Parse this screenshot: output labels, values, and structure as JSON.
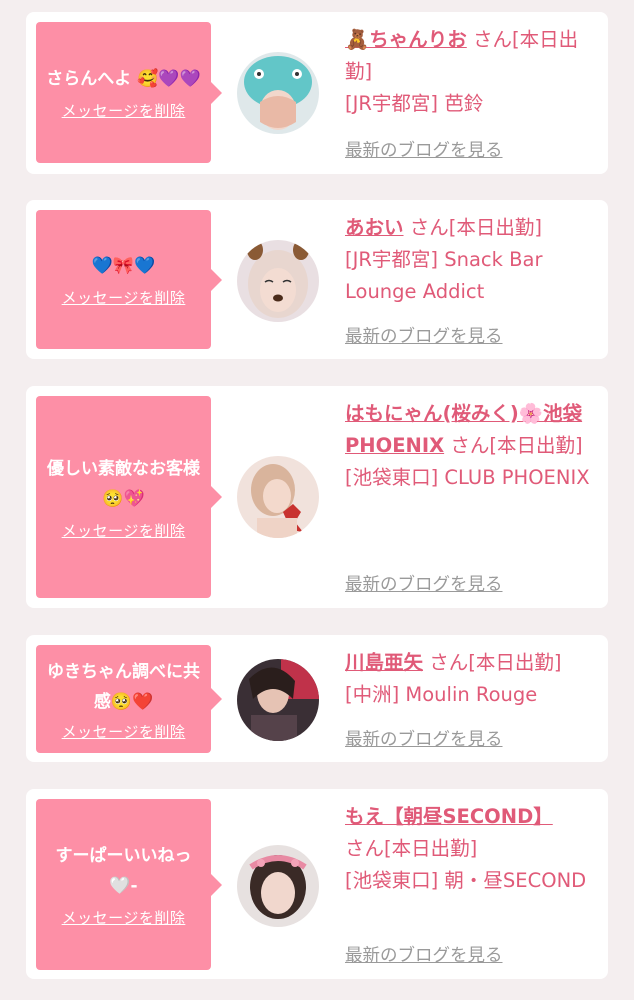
{
  "delete_label": "メッセージを削除",
  "blog_label": "最新のブログを見る",
  "honorific": "さん",
  "messages": [
    {
      "message": "さらんへよ 🥰💜💜",
      "name": "🧸ちゃんりお",
      "status": "[本日出勤]",
      "location": "[JR宇都宮] 芭鈴"
    },
    {
      "message": "💙🎀💙",
      "name": "あおい",
      "status": "[本日出勤]",
      "location": "[JR宇都宮] Snack Bar Lounge Addict"
    },
    {
      "message": "優しい素敵なお客様🥺💖",
      "name": "はもにゃん(桜みく)🌸池袋PHOENIX",
      "status": "[本日出勤]",
      "location": "[池袋東口] CLUB PHOENIX"
    },
    {
      "message": "ゆきちゃん調べに共感🥺❤️",
      "name": "川島亜矢",
      "status": "[本日出勤]",
      "location": "[中洲] Moulin Rouge"
    },
    {
      "message": "すーぱーいいねっ🤍-",
      "name": "もえ【朝昼SECOND】",
      "status": "[本日出勤]",
      "location": "[池袋東口] 朝・昼SECOND"
    }
  ],
  "colors": {
    "background": "#f4eeef",
    "bubble": "#fd8fa6",
    "accent_text": "#e05a78",
    "link_gray": "#9a9a9a"
  }
}
